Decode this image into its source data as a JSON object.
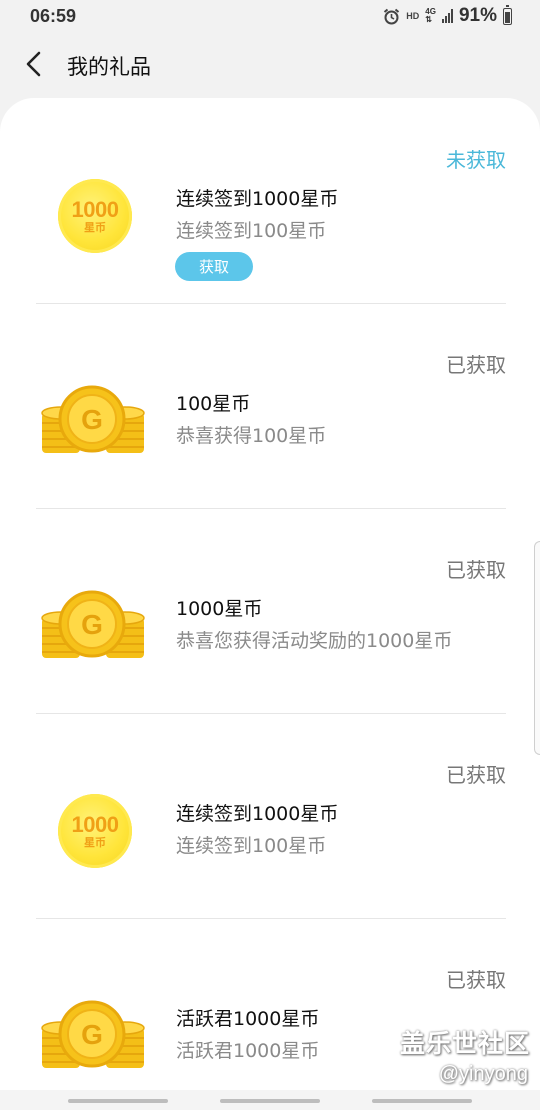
{
  "status_bar": {
    "time": "06:59",
    "hd": "HD",
    "network": "4G",
    "battery": "91%"
  },
  "header": {
    "title": "我的礼品"
  },
  "gifts": [
    {
      "status": "未获取",
      "title": "连续签到1000星币",
      "subtitle": "连续签到100星币",
      "icon": "coin-1000-icon",
      "claim_label": "获取"
    },
    {
      "status": "已获取",
      "title": "100星币",
      "subtitle": "恭喜获得100星币",
      "icon": "coin-stack-icon"
    },
    {
      "status": "已获取",
      "title": "1000星币",
      "subtitle": "恭喜您获得活动奖励的1000星币",
      "icon": "coin-stack-icon"
    },
    {
      "status": "已获取",
      "title": "连续签到1000星币",
      "subtitle": "连续签到100星币",
      "icon": "coin-1000-icon"
    },
    {
      "status": "已获取",
      "title": "活跃君1000星币",
      "subtitle": "活跃君1000星币",
      "icon": "coin-stack-icon"
    }
  ],
  "coin_label": {
    "amount": "1000",
    "unit": "星币",
    "stack_letter": "G"
  },
  "watermark": {
    "line1": "盖乐世社区",
    "line2": "@yinyong"
  },
  "colors": {
    "accent": "#5cc6ea",
    "pending_status": "#4bb8d9",
    "coin_gold": "#f5c518"
  }
}
